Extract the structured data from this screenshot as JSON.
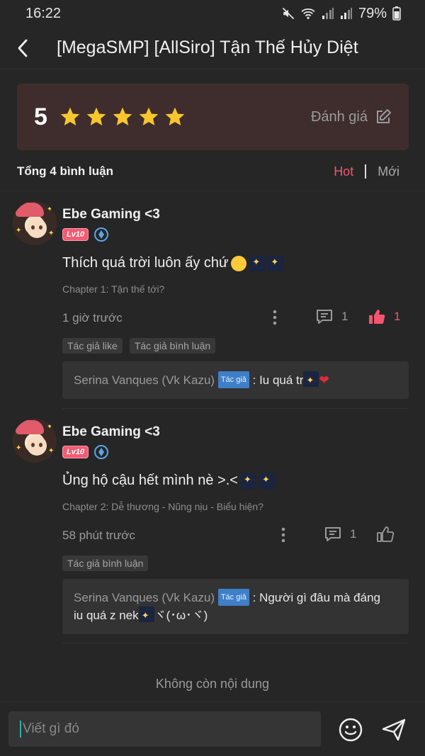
{
  "status_bar": {
    "time": "16:22",
    "battery": "79%"
  },
  "header": {
    "title": "[MegaSMP] [AllSiro] Tận Thế Hủy Diệt",
    "back_icon": "chevron-left-icon"
  },
  "rating": {
    "score": "5",
    "stars": 5,
    "rate_label": "Đánh giá",
    "star_color": "#f7c62f",
    "card_color": "#3f2d2d"
  },
  "comments_header": {
    "total": "Tổng 4 bình luận",
    "sort_hot": "Hot",
    "sort_new": "Mới",
    "accent": "#f2566f"
  },
  "comments": [
    {
      "user": "Ebe Gaming <3",
      "level": "Lv10",
      "text": "Thích quá trời luôn ấy chứ",
      "chapter": "Chapter 1: Tận thế tới?",
      "time": "1 giờ trước",
      "replies": "1",
      "likes": "1",
      "liked": true,
      "tags": [
        "Tác giả like",
        "Tác giả bình luận"
      ],
      "reply": {
        "author": "Serina Vanques (Vk Kazu)",
        "author_tag": "Tác giả",
        "text": ": Iu quá tr"
      }
    },
    {
      "user": "Ebe Gaming <3",
      "level": "Lv10",
      "text": "Ủng hộ cậu hết mình nè >.<",
      "chapter": "Chapter 2: Dễ thương - Nũng nịu - Biểu hiện?",
      "time": "58 phút trước",
      "replies": "1",
      "likes": "",
      "liked": false,
      "tags": [
        "Tác giả bình luận"
      ],
      "reply": {
        "author": "Serina Vanques (Vk Kazu)",
        "author_tag": "Tác giả",
        "text": ": Người gì đâu mà đáng",
        "text2": "iu quá z nek",
        "text3": "ヾ(･ω･ヾ)"
      }
    }
  ],
  "footer": {
    "no_more": "Không còn nội dung"
  },
  "input": {
    "placeholder": "Viết gì đó"
  }
}
